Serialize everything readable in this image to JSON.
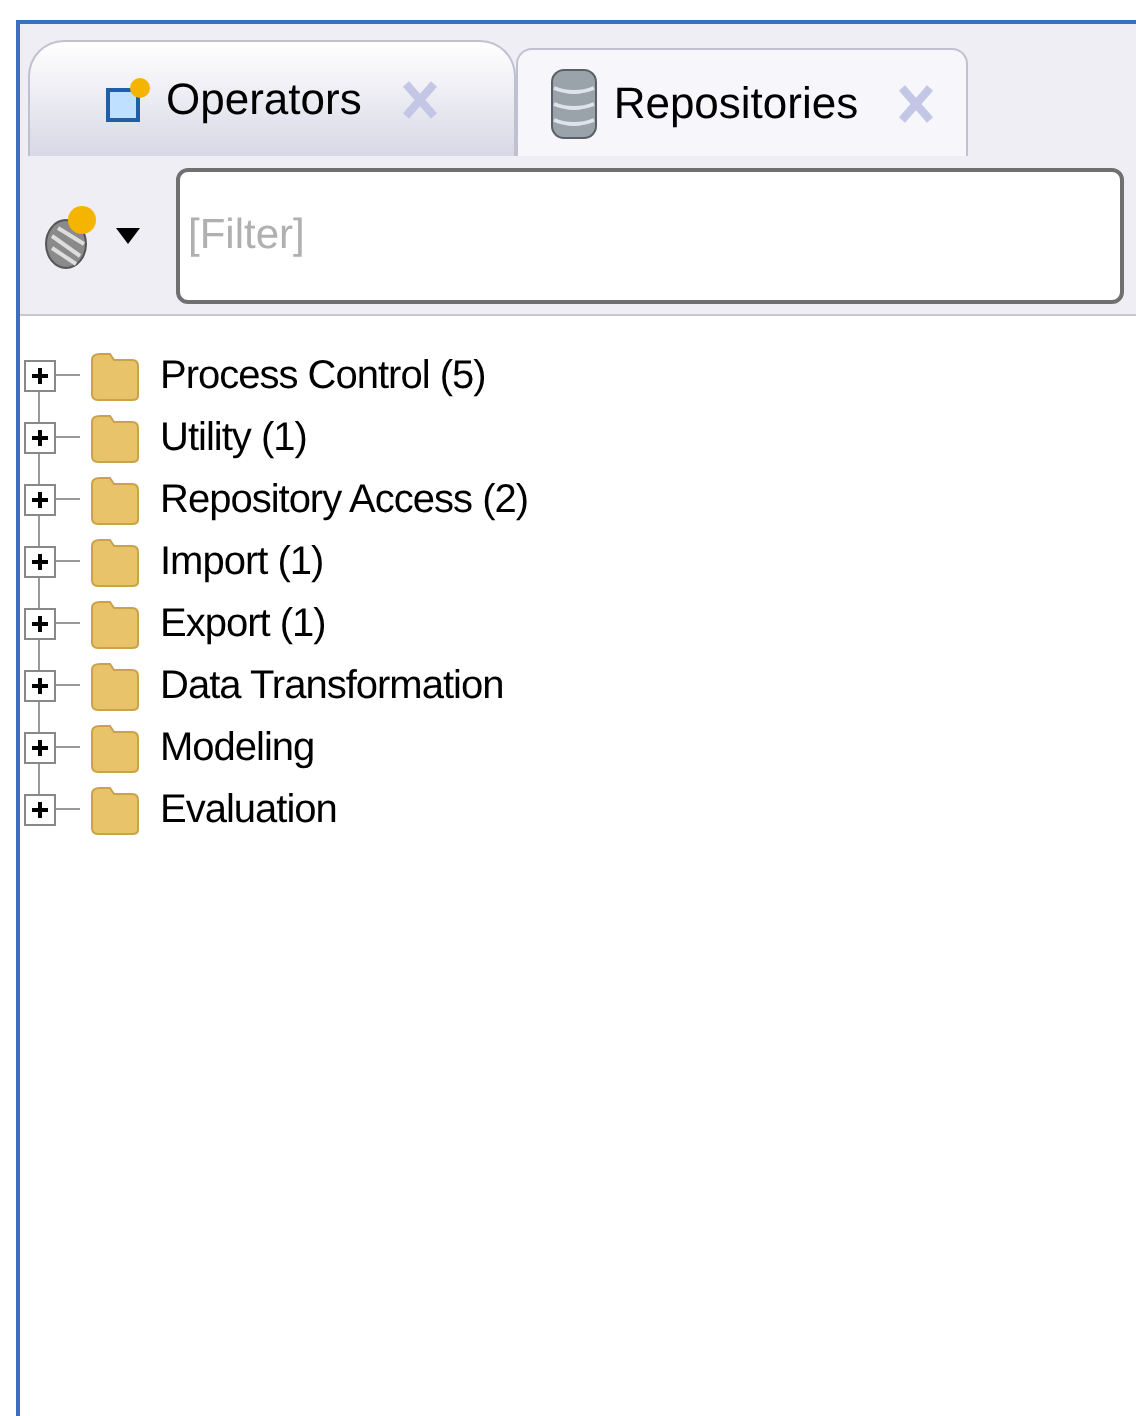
{
  "tabs": [
    {
      "label": "Operators",
      "kind": "operators",
      "selected": true
    },
    {
      "label": "Repositories",
      "kind": "repository",
      "selected": false
    }
  ],
  "filter": {
    "placeholder": "[Filter]"
  },
  "tree": [
    {
      "label": "Process Control (5)",
      "expanded": false
    },
    {
      "label": "Utility (1)",
      "expanded": false
    },
    {
      "label": "Repository Access (2)",
      "expanded": false
    },
    {
      "label": "Import (1)",
      "expanded": false
    },
    {
      "label": "Export (1)",
      "expanded": false
    },
    {
      "label": "Data Transformation",
      "expanded": false
    },
    {
      "label": "Modeling",
      "expanded": false
    },
    {
      "label": "Evaluation",
      "expanded": false
    }
  ]
}
